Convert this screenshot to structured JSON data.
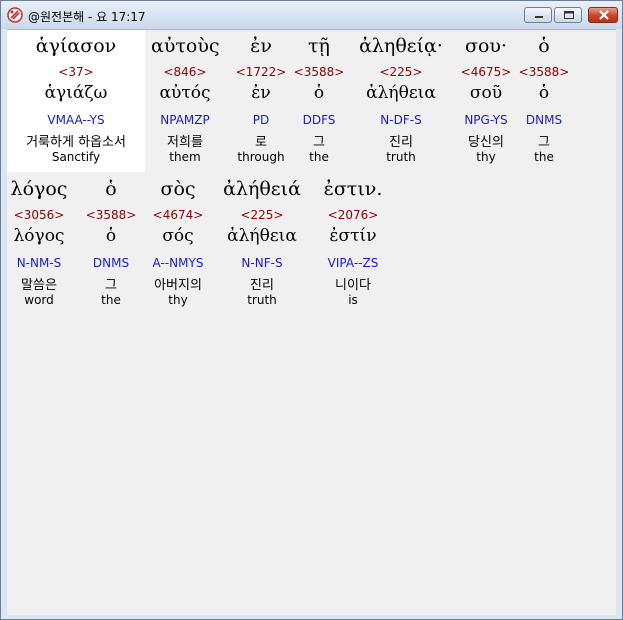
{
  "window": {
    "title": "@원전본해 - 요 17:17",
    "app_icon": "bible-app-icon"
  },
  "colors": {
    "strongs_number": "#8b0000",
    "parsing_code": "#1a1acc",
    "highlight_bg": "#ffffff"
  },
  "lines": [
    {
      "words": [
        {
          "greek": "ἁγίασον",
          "strongs": "<37>",
          "lemma": "ἁγιάζω",
          "parse": "VMAA--YS",
          "korean": "거룩하게 하옵소서",
          "english": "Sanctify",
          "highlighted": true
        },
        {
          "greek": "αὐτοὺς",
          "strongs": "<846>",
          "lemma": "αὐτός",
          "parse": "NPAMZP",
          "korean": "저희를",
          "english": "them",
          "highlighted": false
        },
        {
          "greek": "ἐν",
          "strongs": "<1722>",
          "lemma": "ἐν",
          "parse": "PD",
          "korean": "로",
          "english": "through",
          "highlighted": false
        },
        {
          "greek": "τῇ",
          "strongs": "<3588>",
          "lemma": "ὁ",
          "parse": "DDFS",
          "korean": "그",
          "english": "the",
          "highlighted": false
        },
        {
          "greek": "ἀληθείᾳ·",
          "strongs": "<225>",
          "lemma": "ἀλήθεια",
          "parse": "N-DF-S",
          "korean": "진리",
          "english": "truth",
          "highlighted": false
        },
        {
          "greek": "σου·",
          "strongs": "<4675>",
          "lemma": "σοῦ",
          "parse": "NPG-YS",
          "korean": "당신의",
          "english": "thy",
          "highlighted": false
        },
        {
          "greek": "ὁ",
          "strongs": "<3588>",
          "lemma": "ὁ",
          "parse": "DNMS",
          "korean": "그",
          "english": "the",
          "highlighted": false
        }
      ]
    },
    {
      "words": [
        {
          "greek": "λόγος",
          "strongs": "<3056>",
          "lemma": "λόγος",
          "parse": "N-NM-S",
          "korean": "말씀은",
          "english": "word",
          "highlighted": false
        },
        {
          "greek": "ὁ",
          "strongs": "<3588>",
          "lemma": "ὁ",
          "parse": "DNMS",
          "korean": "그",
          "english": "the",
          "highlighted": false
        },
        {
          "greek": "σὸς",
          "strongs": "<4674>",
          "lemma": "σός",
          "parse": "A--NMYS",
          "korean": "아버지의",
          "english": "thy",
          "highlighted": false
        },
        {
          "greek": "ἀλήθειά",
          "strongs": "<225>",
          "lemma": "ἀλήθεια",
          "parse": "N-NF-S",
          "korean": "진리",
          "english": "truth",
          "highlighted": false
        },
        {
          "greek": "ἐστιν.",
          "strongs": "<2076>",
          "lemma": "ἐστίν",
          "parse": "VIPA--ZS",
          "korean": "니이다",
          "english": "is",
          "highlighted": false
        }
      ]
    }
  ]
}
